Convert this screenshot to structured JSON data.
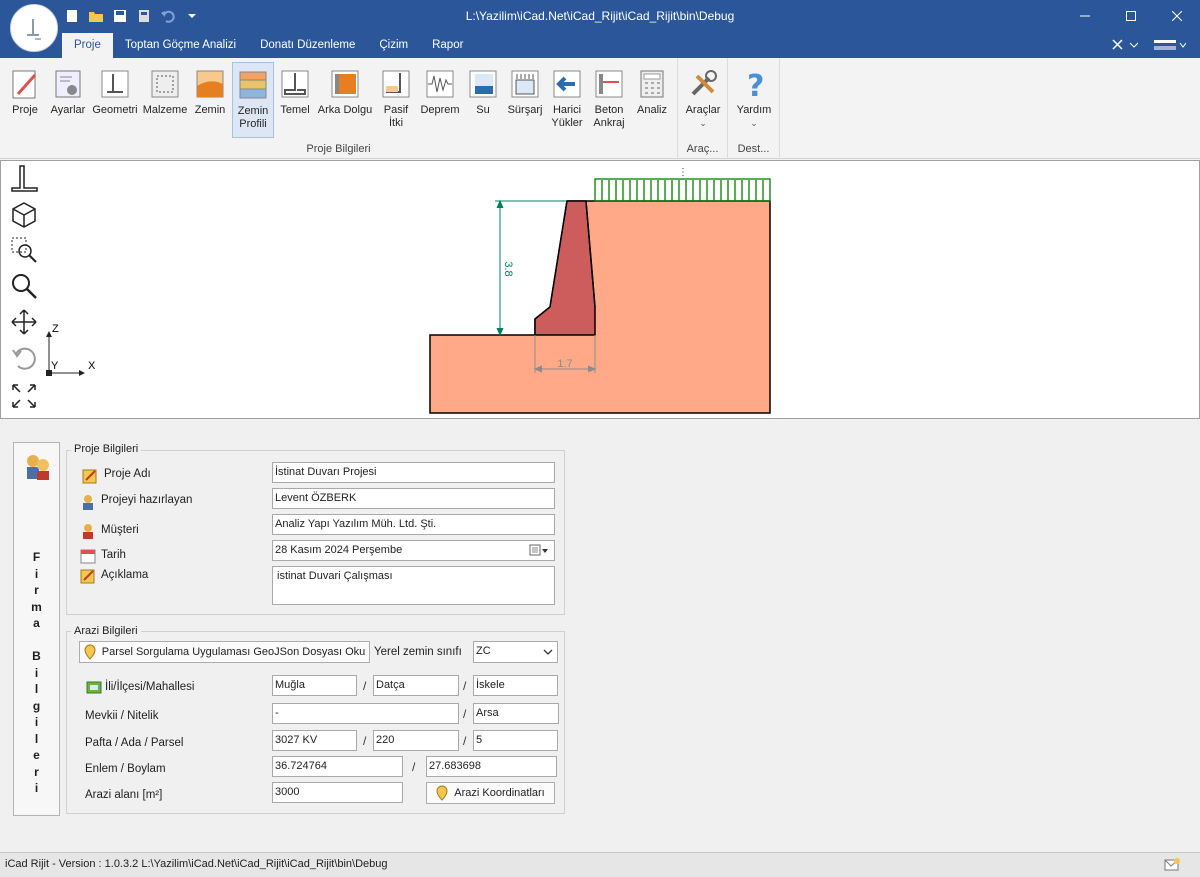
{
  "window": {
    "title": "L:\\Yazilim\\iCad.Net\\iCad_Rijit\\iCad_Rijit\\bin\\Debug"
  },
  "tabs": [
    {
      "label": "Proje"
    },
    {
      "label": "Toptan Göçme Analizi"
    },
    {
      "label": "Donatı Düzenleme"
    },
    {
      "label": "Çizim"
    },
    {
      "label": "Rapor"
    }
  ],
  "ribbon": {
    "buttons": [
      {
        "label": "Proje"
      },
      {
        "label": "Ayarlar"
      },
      {
        "label": "Geometri"
      },
      {
        "label": "Malzeme"
      },
      {
        "label": "Zemin"
      },
      {
        "label": "Zemin\nProfili"
      },
      {
        "label": "Temel"
      },
      {
        "label": "Arka Dolgu"
      },
      {
        "label": "Pasif\nİtki"
      },
      {
        "label": "Deprem"
      },
      {
        "label": "Su"
      },
      {
        "label": "Sürşarj"
      },
      {
        "label": "Harici\nYükler"
      },
      {
        "label": "Beton\nAnkraj"
      },
      {
        "label": "Analiz"
      }
    ],
    "group_label": "Proje Bilgileri",
    "tools_label": "Araçlar",
    "tools_group": "Araç...",
    "help_label": "Yardım",
    "help_group": "Dest..."
  },
  "drawing": {
    "height_dim": "3.8",
    "base_dim": "1.7",
    "axis_z": "Z",
    "axis_y": "Y",
    "axis_x": "X"
  },
  "firma": {
    "label": "F\ni\nr\nm\na\n\nB\ni\nl\ng\ni\nl\ne\nr\ni"
  },
  "proje": {
    "title": "Proje Bilgileri",
    "name_label": "Proje Adı",
    "name_value": "İstinat Duvarı Projesi",
    "author_label": "Projeyi hazırlayan",
    "author_value": "Levent ÖZBERK",
    "client_label": "Müşteri",
    "client_value": "Analiz Yapı Yazılım Müh. Ltd. Şti.",
    "date_label": "Tarih",
    "date_value": "28   Kasım    2024 Perşembe",
    "desc_label": "Açıklama",
    "desc_value": "istinat Duvari Çalışması"
  },
  "arazi": {
    "title": "Arazi  Bilgileri",
    "parsel_button": "Parsel Sorgulama Uygulaması GeoJSon Dosyası Oku",
    "zemin_label": "Yerel zemin sınıfı",
    "zemin_value": "ZC",
    "il_label": "İli/İlçesi/Mahallesi",
    "il_value": "Muğla",
    "ilce_value": "Datça",
    "mahalle_value": "İskele",
    "mevkii_label": "Mevkii / Nitelik",
    "mevkii_value": "-",
    "nitelik_value": "Arsa",
    "pafta_label": "Pafta / Ada / Parsel",
    "pafta_value": "3027 KV",
    "ada_value": "220",
    "parsel_value": "5",
    "enlem_label": "Enlem / Boylam",
    "enlem_value": "36.724764",
    "boylam_value": "27.683698",
    "alan_label": "Arazi  alanı  [m²]",
    "alan_value": "3000",
    "koord_button": "Arazi Koordinatları",
    "slash": "/"
  },
  "status": {
    "text": "iCad Rijit - Version : 1.0.3.2  L:\\Yazilim\\iCad.Net\\iCad_Rijit\\iCad_Rijit\\bin\\Debug"
  },
  "colors": {
    "titlebar": "#2b579a",
    "soil": "#ffa989",
    "wall": "#cd5c5c",
    "surcharge": "#008000",
    "dimension": "#008060"
  }
}
